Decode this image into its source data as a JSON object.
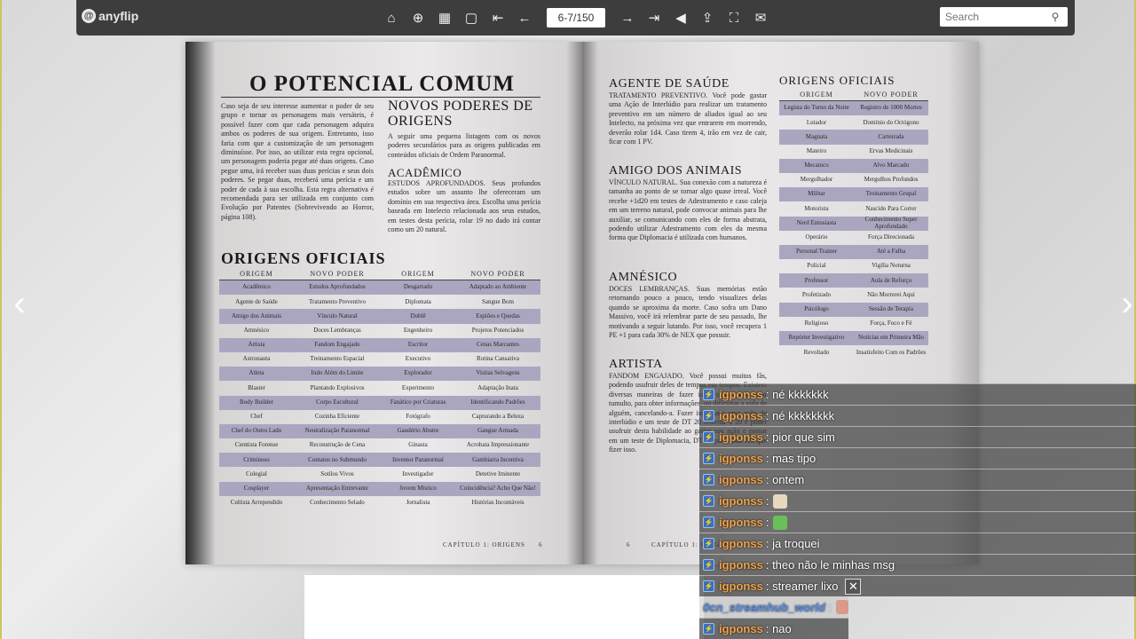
{
  "toolbar": {
    "logo_text": "anyflip",
    "page_indicator": "6-7/150",
    "search_placeholder": "Search",
    "icons": [
      "home-icon",
      "zoom-in-icon",
      "thumbnails-icon",
      "single-page-icon",
      "first-page-icon",
      "prev-page-icon",
      "next-page-icon",
      "last-page-icon",
      "sound-icon",
      "share-icon",
      "fullscreen-icon",
      "mail-icon"
    ]
  },
  "left_page": {
    "title": "O POTENCIAL COMUM",
    "intro": "Caso seja de seu interesse aumentar o poder de seu grupo e tornar os personagens mais versáteis, é possível fazer com que cada personagem adquira ambos os poderes de sua origem. Entretanto, isso faria com que a customização de um personagem diminuísse. Por isso, ao utilizar esta regra opcional, um personagem poderia pegar até duas origens. Caso pegue uma, irá receber suas duas perícias e seus dois poderes. Se pegar duas, receberá uma perícia e um poder de cada à sua escolha. Esta regra alternativa é recomendada para ser utilizada em conjunto com Evolução por Patentes (Sobrevivendo ao Horror, página 108).",
    "novos_title": "NOVOS PODERES DE ORIGENS",
    "novos_text": "A seguir uma pequena listagem com os novos poderes secundários para as origens publicadas em conteúdos oficiais de Ordem Paranormal.",
    "academico_title": "ACADÊMICO",
    "academico_text": "ESTUDOS APROFUNDADOS. Seus profundos estudos sobre um assunto lhe ofereceram um domínio em sua respectiva área. Escolha uma perícia baseada em Intelecto relacionada aos seus estudos, em testes desta perícia, rolar 19 no dado irá contar como um 20 natural.",
    "table_title": "ORIGENS OFICIAIS",
    "table_headers": [
      "ORIGEM",
      "NOVO PODER",
      "ORIGEM",
      "NOVO PODER"
    ],
    "table_rows": [
      [
        "Acadêmico",
        "Estudos Aprofundados",
        "Desgarrado",
        "Adaptado ao Ambiente"
      ],
      [
        "Agente de Saúde",
        "Tratamento Preventivo",
        "Diplomata",
        "Sangue Bom"
      ],
      [
        "Amigo dos Animais",
        "Vínculo Natural",
        "Dublê",
        "Espiões e Quedas"
      ],
      [
        "Amnésico",
        "Doces Lembranças",
        "Engenheiro",
        "Projetos Potenciados"
      ],
      [
        "Artista",
        "Fandom Engajado",
        "Escritor",
        "Cenas Marcantes"
      ],
      [
        "Astronauta",
        "Treinamento Espacial",
        "Executivo",
        "Rotina Cansativa"
      ],
      [
        "Atleta",
        "Indo Além do Limite",
        "Explorador",
        "Visitas Selvagens"
      ],
      [
        "Blaster",
        "Plantando Explosivos",
        "Experimento",
        "Adaptação Inata"
      ],
      [
        "Body Builder",
        "Corpo Escultural",
        "Fanático por Criaturas",
        "Identificando Padrões"
      ],
      [
        "Chef",
        "Cozinha Eficiente",
        "Fotógrafo",
        "Capturando a Beleza"
      ],
      [
        "Chef do Outro Lado",
        "Neutralização Paranormal",
        "Gaudério Abutre",
        "Gangue Armada"
      ],
      [
        "Cientista Forense",
        "Reconstrução de Cena",
        "Ginasta",
        "Acrobata Impressionante"
      ],
      [
        "Criminoso",
        "Contatos no Submundo",
        "Inventor Paranormal",
        "Gambiarra Incentiva"
      ],
      [
        "Colegial",
        "Sotilos Vivos",
        "Investigador",
        "Detetive Iminente"
      ],
      [
        "Cosplayer",
        "Apresentação Entrevante",
        "Jovem Místico",
        "Coincidência? Acho Que Não!"
      ],
      [
        "Cultista Arrependido",
        "Conhecimento Selado",
        "Jornalista",
        "Histórias Incontáveis"
      ]
    ],
    "footer": "CAPÍTULO 1: ORIGENS",
    "page_num": "6"
  },
  "right_page": {
    "agente_title": "AGENTE DE SAÚDE",
    "agente_text": "TRATAMENTO PREVENTIVO. Você pode gastar uma Ação de Interlúdio para realizar um tratamento preventivo em um número de aliados igual ao seu Intelecto, na próxima vez que entrarem em morrendo, deverão rolar 1d4. Caso tirem 4, irão em vez de cair, ficar com 1 PV.",
    "amigo_title": "AMIGO DOS ANIMAIS",
    "amigo_text": "VÍNCULO NATURAL. Sua conexão com a natureza é tamanha ao ponto de se tornar algo quase irreal. Você recebe +1d20 em testes de Adestramento e caso caleja em um terreno natural, pode convocar animais para lhe auxiliar, se comunicando com eles de forma abstrata, podendo utilizar Adestramento com eles da mesma forma que Diplomacia é utilizada com humanos.",
    "amnesico_title": "AMNÉSICO",
    "amnesico_text": "DOCES LEMBRANÇAS. Suas memórias estão retornando pouco a pouco, tendo visualizes delas quando se aproxima da morte. Caso sofra um Dano Massivo, você irá relembrar parte de seu passado, lhe motivando a seguir lutando. Por isso, você recupera 1 PE +1 para cada 30% de NEX que possuir.",
    "artista_title": "ARTISTA",
    "artista_text": "FANDOM ENGAJADO. Você possui muitos fãs, podendo usufruir deles de tempos em tempos. Existem diversas maneiras de fazer isso, como para criar tumulto, para obter informações, ou dificultar a vida de alguém, cancelando-a. Fazer isso custa uma ação de interlúdio e um teste de DT 20 retornar a 20 e poder usufruir desta habilidade ao gastar sua ação e passar em um teste de Diplomacia, DT 15 para cada vez que fizer isso.",
    "table_title": "ORIGENS OFICIAIS",
    "table_headers": [
      "ORIGEM",
      "NOVO PODER"
    ],
    "table_rows": [
      [
        "Legista do Turno da Noite",
        "Registro de 1000 Mortes"
      ],
      [
        "Lutador",
        "Domínio do Octógono"
      ],
      [
        "Magnata",
        "Carteirada"
      ],
      [
        "Mateiro",
        "Ervas Medicinais"
      ],
      [
        "Mecanico",
        "Alvo Marcado"
      ],
      [
        "Mergulhador",
        "Mergulhos Profundos"
      ],
      [
        "Militar",
        "Treinamento Grupal"
      ],
      [
        "Motorista",
        "Nascido Para Correr"
      ],
      [
        "Nerd Entusiasta",
        "Conhecimento Super Aprofundado"
      ],
      [
        "Operário",
        "Força Direcionada"
      ],
      [
        "Personal Trainer",
        "Até a Falha"
      ],
      [
        "Policial",
        "Vigília Noturna"
      ],
      [
        "Professor",
        "Aula de Reforço"
      ],
      [
        "Profetizado",
        "Não Morrerei Aqui"
      ],
      [
        "Psicólogo",
        "Sessão de Terapia"
      ],
      [
        "Religioso",
        "Força, Foco e Fé"
      ],
      [
        "Repórter Investigativo",
        "Notícias em Primeira Mão"
      ],
      [
        "Revoltado",
        "Insatisfeito Com os Padrões"
      ]
    ],
    "footer": "CAPÍTULO 1: ORIGENS",
    "page_num": "6"
  },
  "chat": [
    {
      "user": "igponss",
      "msg": ": né kkkkkkk",
      "style": "gray"
    },
    {
      "user": "igponss",
      "msg": ": né kkkkkkkk",
      "style": "gray"
    },
    {
      "user": "igponss",
      "msg": ": pior que sim",
      "style": "gray"
    },
    {
      "user": "igponss",
      "msg": ": mas tipo",
      "style": "gray"
    },
    {
      "user": "igponss",
      "msg": ": ontem",
      "style": "gray"
    },
    {
      "user": "igponss",
      "msg": ":",
      "style": "gray",
      "emote": "thumb-emote"
    },
    {
      "user": "igponss",
      "msg": ":",
      "style": "gray",
      "emote": "frog-emote"
    },
    {
      "user": "igponss",
      "msg": ": ja troquei",
      "style": "gray"
    },
    {
      "user": "igponss",
      "msg": ": theo não le minhas msg",
      "style": "gray"
    },
    {
      "user": "igponss",
      "msg": ": streamer lixo",
      "style": "gray",
      "close": true
    },
    {
      "user": "0cn_streamhub_world",
      "msg": ":",
      "style": "light",
      "emote": "face-emote"
    },
    {
      "user": "igponss",
      "msg": ": nao",
      "style": "gray"
    }
  ],
  "colors": {
    "toolbar_bg": "#3d3d3d",
    "table_shade": "#aba6c0",
    "chat_username": "#f0a24a",
    "chat_username_alt": "#5b8fe6"
  }
}
